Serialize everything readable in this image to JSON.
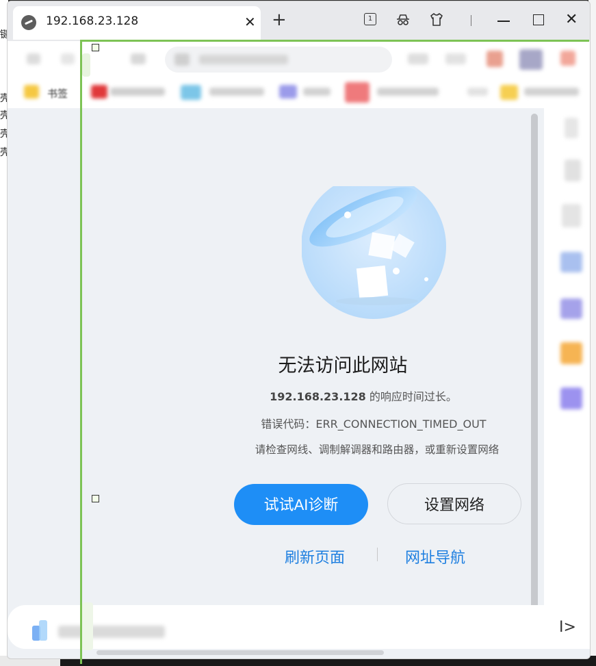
{
  "tab": {
    "title": "192.168.23.128",
    "close_label": "✕"
  },
  "new_tab_label": "+",
  "tab_count": "1",
  "window_controls": {
    "close": "✕"
  },
  "bookmarks": {
    "first_label": "书签"
  },
  "error": {
    "title": "无法访问此网站",
    "host": "192.168.23.128",
    "host_suffix": " 的响应时间过长。",
    "code_line": "错误代码：ERR_CONNECTION_TIMED_OUT",
    "suggestion": "请检查网线、调制解调器和路由器，或重新设置网络"
  },
  "buttons": {
    "ai_diagnose": "试试AI诊断",
    "network_settings": "设置网络"
  },
  "links": {
    "refresh": "刷新页面",
    "site_nav": "网址导航"
  },
  "bottom": {
    "expand_arrow": "I>"
  },
  "background_chars": [
    "键",
    "壳",
    "壳",
    "壳",
    "壳"
  ],
  "colors": {
    "accent": "#1e8ef6",
    "link": "#1e7fe0",
    "selection": "#7dc355"
  }
}
